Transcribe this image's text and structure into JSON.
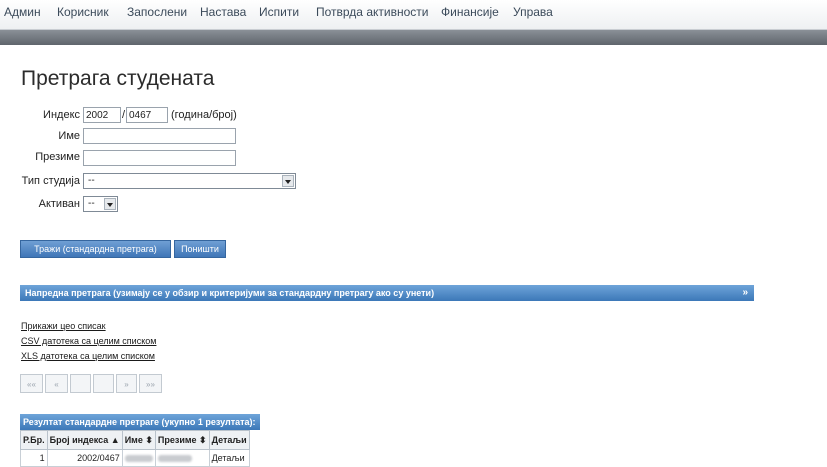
{
  "menu": [
    "Админ",
    "Корисник",
    "Запослени",
    "Настава",
    "Испити",
    "Потврда активности",
    "Финансије",
    "Управа"
  ],
  "page_title": "Претрага студената",
  "form": {
    "index_label": "Индекс",
    "index_year_value": "2002",
    "index_separator": "/",
    "index_number_value": "0467",
    "index_hint": "(година/број)",
    "first_name_label": "Име",
    "first_name_value": "",
    "last_name_label": "Презиме",
    "last_name_value": "",
    "study_type_label": "Тип студија",
    "study_type_selected": "--",
    "active_label": "Активан",
    "active_selected": "--"
  },
  "buttons": {
    "search": "Тражи (стандардна претрага)",
    "cancel": "Поништи"
  },
  "advanced_search": {
    "label": "Напредна претрага (узимају се у обзир и критеријуми за стандардну претрагу ако су унети)",
    "chevron": "»"
  },
  "links": {
    "show_all": "Прикажи цео списак",
    "csv": "CSV датотека са целим списком",
    "xls": "XLS датотека са целим списком"
  },
  "pager": {
    "first": "««",
    "prev": "«",
    "next": "»",
    "last": "»»"
  },
  "results": {
    "title": "Резултат стандардне претраге (укупно 1 резултата):",
    "columns": [
      "Р.Бр.",
      "Број индекса ▲",
      "Име ⬍",
      "Презиме ⬍",
      "Детаљи"
    ],
    "rows": [
      {
        "rb": "1",
        "index": "2002/0467",
        "details": "Детаљи"
      }
    ]
  }
}
